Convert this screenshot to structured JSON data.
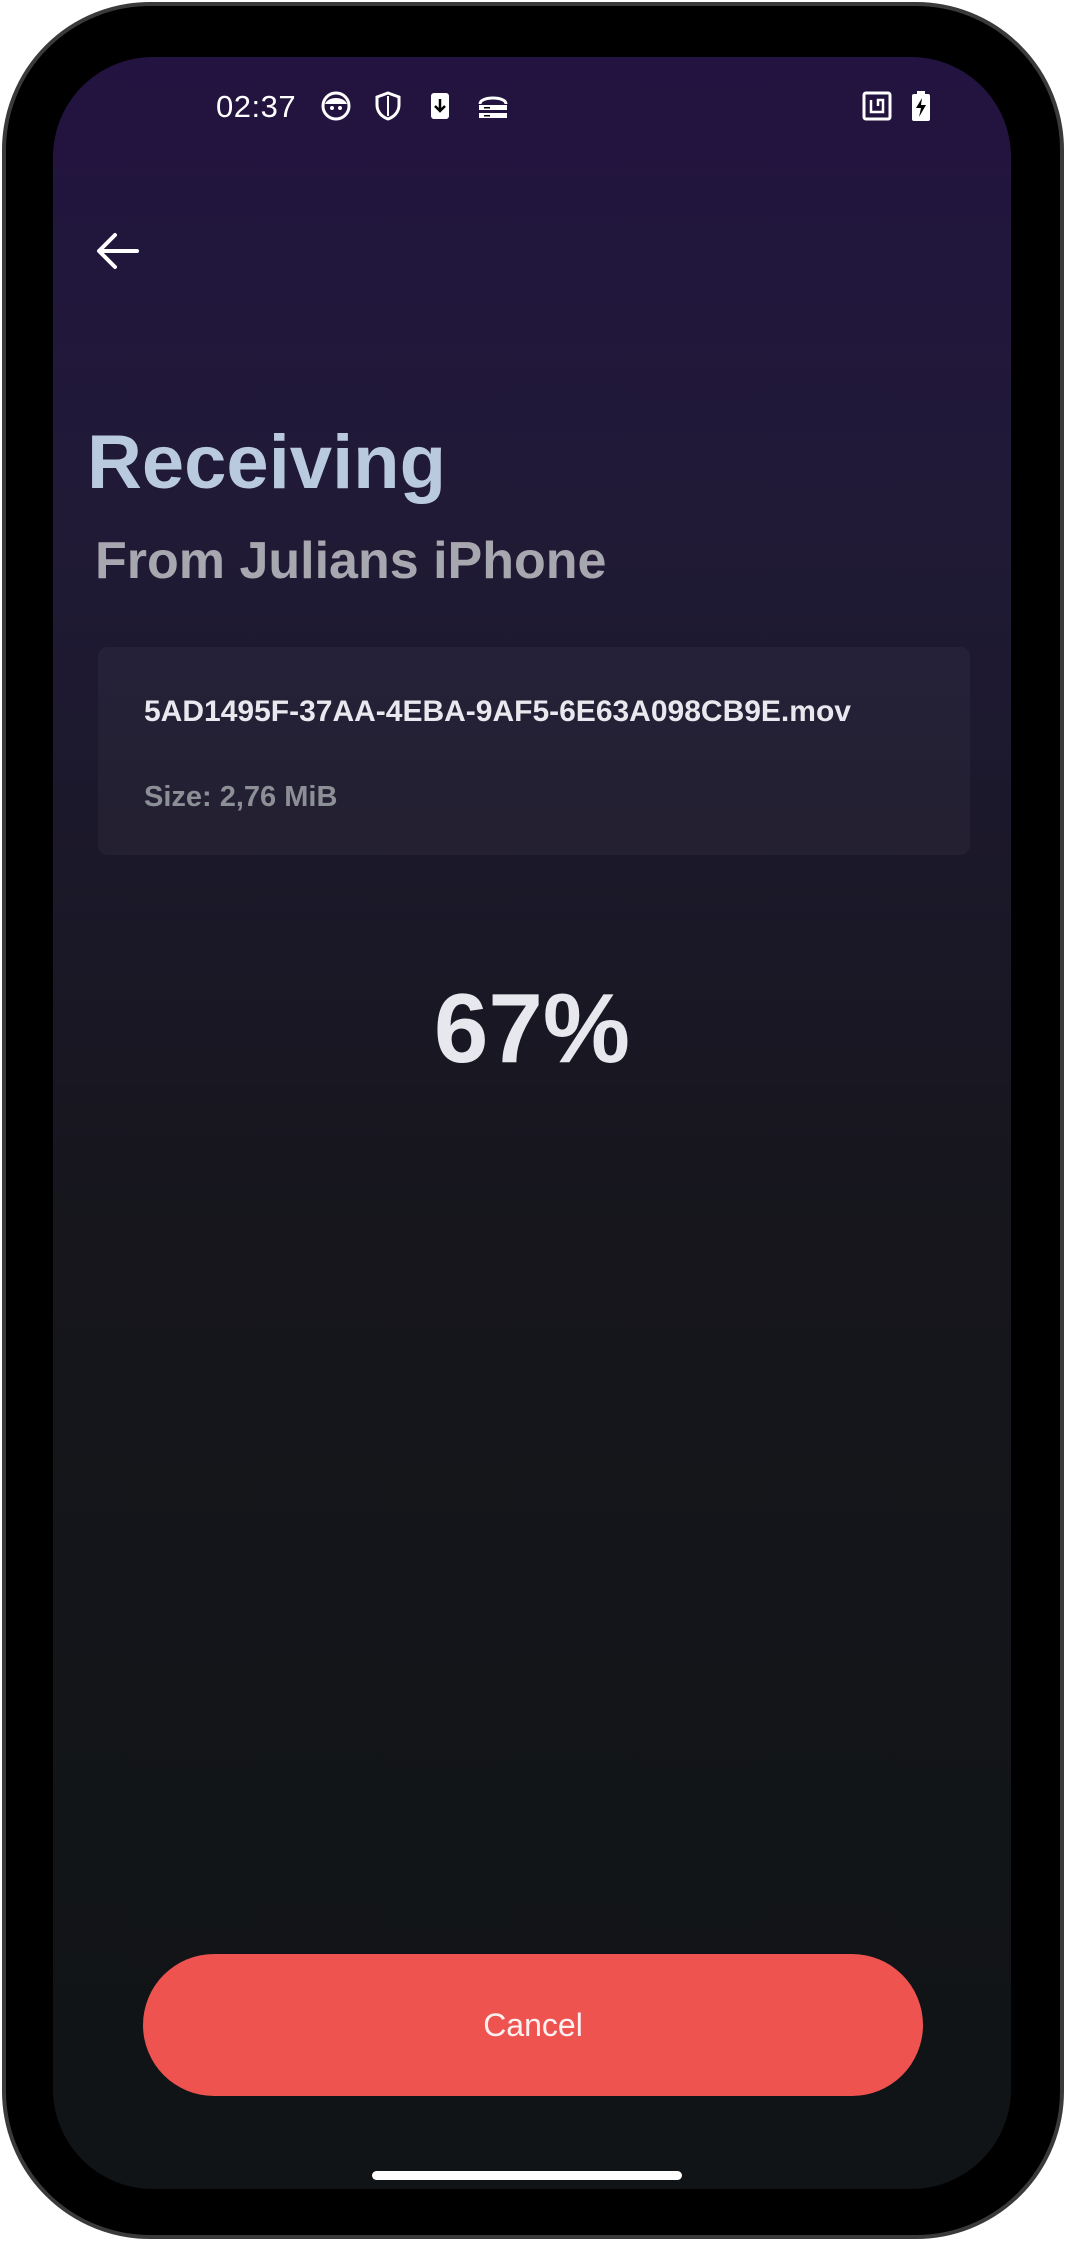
{
  "status_bar": {
    "time": "02:37",
    "icons": [
      "face-icon",
      "shield-icon",
      "download-icon",
      "server-icon",
      "nfc-icon",
      "battery-charging-icon"
    ]
  },
  "header": {
    "back_icon": "arrow-left-icon"
  },
  "main": {
    "title": "Receiving",
    "subtitle": "From Julians iPhone",
    "file": {
      "name": "5AD1495F-37AA-4EBA-9AF5-6E63A098CB9E.mov",
      "size": "Size: 2,76 MiB"
    },
    "progress": "67%"
  },
  "footer": {
    "cancel_label": "Cancel"
  },
  "colors": {
    "accent": "#ef5350",
    "title": "#b9cadf",
    "background_top": "#221340",
    "background_bottom": "#101416"
  }
}
